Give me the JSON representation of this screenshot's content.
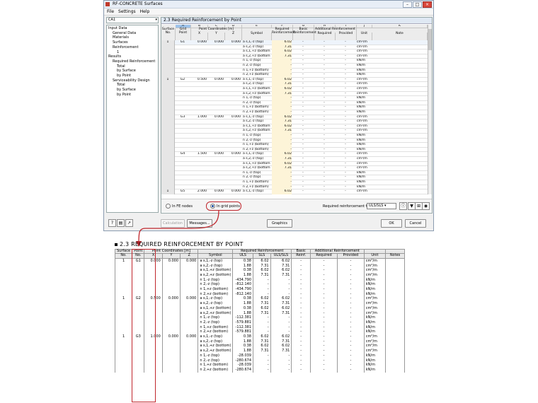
{
  "window": {
    "title": "RF-CONCRETE Surfaces",
    "menu": [
      "File",
      "Settings",
      "Help"
    ],
    "case_select": "CA1",
    "tree": [
      {
        "label": "Input Data",
        "level": 0
      },
      {
        "label": "General Data",
        "level": 1
      },
      {
        "label": "Materials",
        "level": 1
      },
      {
        "label": "Surfaces",
        "level": 1
      },
      {
        "label": "Reinforcement",
        "level": 1
      },
      {
        "label": "1",
        "level": 2
      },
      {
        "label": "Results",
        "level": 0
      },
      {
        "label": "Required Reinforcement",
        "level": 1
      },
      {
        "label": "Total",
        "level": 2
      },
      {
        "label": "by Surface",
        "level": 2
      },
      {
        "label": "by Point",
        "level": 2
      },
      {
        "label": "Serviceability Design",
        "level": 1
      },
      {
        "label": "Total",
        "level": 2
      },
      {
        "label": "by Surface",
        "level": 2
      },
      {
        "label": "by Point",
        "level": 2
      }
    ],
    "panel_title": "2.3 Required Reinforcement by Point",
    "grid_columns": [
      "A",
      "B",
      "C",
      "D",
      "E",
      "F",
      "G",
      "H",
      "I",
      "J",
      "K"
    ],
    "grid_headers": {
      "surface": "Surface No.",
      "grid_point": "Grid Point",
      "coords": "Point Coordinates [m]",
      "x": "X",
      "y": "Y",
      "z": "Z",
      "symbol": "Symbol",
      "required": "Required Reinforcement",
      "basic": "Basic Reinforcement",
      "additional": "Additional Reinforcement",
      "add_required": "Required",
      "add_provided": "Provided",
      "unit": "Unit",
      "note": "Note"
    },
    "grid_points": [
      {
        "surface": "1",
        "point": "G1",
        "x": "0.000",
        "y": "0.000",
        "z": "0.000"
      },
      {
        "surface": "1",
        "point": "G2",
        "x": "0.500",
        "y": "0.000",
        "z": "0.000"
      },
      {
        "surface": "",
        "point": "G3",
        "x": "1.000",
        "y": "0.000",
        "z": "0.000"
      },
      {
        "surface": "",
        "point": "G4",
        "x": "1.500",
        "y": "0.000",
        "z": "0.000"
      },
      {
        "surface": "1",
        "point": "G5",
        "x": "2.000",
        "y": "0.000",
        "z": "0.000"
      }
    ],
    "symbols": [
      "a s,1,-z (top)",
      "a s,2,-z (top)",
      "a s,1,+z (bottom)",
      "a s,2,+z (bottom)",
      "n 1,-z (top)",
      "n 2,-z (top)",
      "n 1,+z (bottom)",
      "n 2,+z (bottom)"
    ],
    "grid_values": [
      "6.02",
      "7.31",
      "6.02",
      "7.31",
      "-",
      "-",
      "-",
      "-"
    ],
    "units": [
      "cm²/m",
      "cm²/m",
      "cm²/m",
      "cm²/m",
      "kN/m",
      "kN/m",
      "kN/m",
      "kN/m"
    ],
    "radio_fe": "In FE nodes",
    "radio_grid": "In grid points",
    "required_for_label": "Required reinforcement for:",
    "required_for_value": "ULS/SLS",
    "buttons": {
      "calculation": "Calculation",
      "messages": "Messages...",
      "graphics": "Graphics",
      "ok": "OK",
      "cancel": "Cancel"
    }
  },
  "report": {
    "title": "2.3 REQUIRED REINFORCEMENT BY POINT",
    "headers": {
      "surface": "Surface",
      "surface2": "No.",
      "point": "Point",
      "point2": "No.",
      "coords": "Point Coordinates [m]",
      "x": "X",
      "y": "Y",
      "z": "Z",
      "symbol": "Symbol",
      "req": "Required Reinforcement",
      "uls": "ULS",
      "sls": "SLS",
      "ulssls": "ULS/SLS",
      "basic": "Basic",
      "basic2": "Reinf.",
      "add": "Additional Reinforcement",
      "add_req": "Required",
      "add_prov": "Provided",
      "unit": "Unit",
      "notes": "Notes"
    },
    "rows": [
      [
        "1",
        "G1",
        "0.000",
        "0.000",
        "0.000",
        "a s,1,-z (top)",
        "0.38",
        "6.02",
        "6.02",
        "-",
        "-",
        "-",
        "cm²/m"
      ],
      [
        "",
        "",
        "",
        "",
        "",
        "a s,2,-z (top)",
        "1.88",
        "7.31",
        "7.31",
        "-",
        "-",
        "-",
        "cm²/m"
      ],
      [
        "",
        "",
        "",
        "",
        "",
        "a s,1,+z (bottom)",
        "0.38",
        "6.02",
        "6.02",
        "-",
        "-",
        "-",
        "cm²/m"
      ],
      [
        "",
        "",
        "",
        "",
        "",
        "a s,2,+z (bottom)",
        "1.88",
        "7.31",
        "7.31",
        "-",
        "-",
        "-",
        "cm²/m"
      ],
      [
        "",
        "",
        "",
        "",
        "",
        "n 1,-z (top)",
        "-434.790",
        "-",
        "-",
        "-",
        "-",
        "-",
        "kN/m"
      ],
      [
        "",
        "",
        "",
        "",
        "",
        "n 2,-z (top)",
        "-812.140",
        "-",
        "-",
        "-",
        "-",
        "-",
        "kN/m"
      ],
      [
        "",
        "",
        "",
        "",
        "",
        "n 1,+z (bottom)",
        "-434.790",
        "-",
        "-",
        "-",
        "-",
        "-",
        "kN/m"
      ],
      [
        "",
        "",
        "",
        "",
        "",
        "n 2,+z (bottom)",
        "-812.140",
        "-",
        "-",
        "-",
        "-",
        "-",
        "kN/m"
      ],
      [
        "1",
        "G2",
        "0.500",
        "0.000",
        "0.000",
        "a s,1,-z (top)",
        "0.38",
        "6.02",
        "6.02",
        "-",
        "-",
        "-",
        "cm²/m"
      ],
      [
        "",
        "",
        "",
        "",
        "",
        "a s,2,-z (top)",
        "1.88",
        "7.31",
        "7.31",
        "-",
        "-",
        "-",
        "cm²/m"
      ],
      [
        "",
        "",
        "",
        "",
        "",
        "a s,1,+z (bottom)",
        "0.38",
        "6.02",
        "6.02",
        "-",
        "-",
        "-",
        "cm²/m"
      ],
      [
        "",
        "",
        "",
        "",
        "",
        "a s,2,+z (bottom)",
        "1.88",
        "7.31",
        "7.31",
        "-",
        "-",
        "-",
        "cm²/m"
      ],
      [
        "",
        "",
        "",
        "",
        "",
        "n 1,-z (top)",
        "-112.381",
        "-",
        "-",
        "-",
        "-",
        "-",
        "kN/m"
      ],
      [
        "",
        "",
        "",
        "",
        "",
        "n 2,-z (top)",
        "-579.881",
        "-",
        "-",
        "-",
        "-",
        "-",
        "kN/m"
      ],
      [
        "",
        "",
        "",
        "",
        "",
        "n 1,+z (bottom)",
        "-112.381",
        "-",
        "-",
        "-",
        "-",
        "-",
        "kN/m"
      ],
      [
        "",
        "",
        "",
        "",
        "",
        "n 2,+z (bottom)",
        "-579.881",
        "-",
        "-",
        "-",
        "-",
        "-",
        "kN/m"
      ],
      [
        "1",
        "G3",
        "1.000",
        "0.000",
        "0.000",
        "a s,1,-z (top)",
        "0.38",
        "6.02",
        "6.02",
        "-",
        "-",
        "-",
        "cm²/m"
      ],
      [
        "",
        "",
        "",
        "",
        "",
        "a s,2,-z (top)",
        "1.88",
        "7.31",
        "7.31",
        "-",
        "-",
        "-",
        "cm²/m"
      ],
      [
        "",
        "",
        "",
        "",
        "",
        "a s,1,+z (bottom)",
        "0.38",
        "6.02",
        "6.02",
        "-",
        "-",
        "-",
        "cm²/m"
      ],
      [
        "",
        "",
        "",
        "",
        "",
        "a s,2,+z (bottom)",
        "1.88",
        "7.31",
        "7.31",
        "-",
        "-",
        "-",
        "cm²/m"
      ],
      [
        "",
        "",
        "",
        "",
        "",
        "n 1,-z (top)",
        "-28.039",
        "-",
        "-",
        "-",
        "-",
        "-",
        "kN/m"
      ],
      [
        "",
        "",
        "",
        "",
        "",
        "n 2,-z (top)",
        "-280.674",
        "-",
        "-",
        "-",
        "-",
        "-",
        "kN/m"
      ],
      [
        "",
        "",
        "",
        "",
        "",
        "n 1,+z (bottom)",
        "-28.039",
        "-",
        "-",
        "-",
        "-",
        "-",
        "kN/m"
      ],
      [
        "",
        "",
        "",
        "",
        "",
        "n 2,+z (bottom)",
        "-280.674",
        "-",
        "-",
        "-",
        "-",
        "-",
        "kN/m"
      ]
    ]
  }
}
